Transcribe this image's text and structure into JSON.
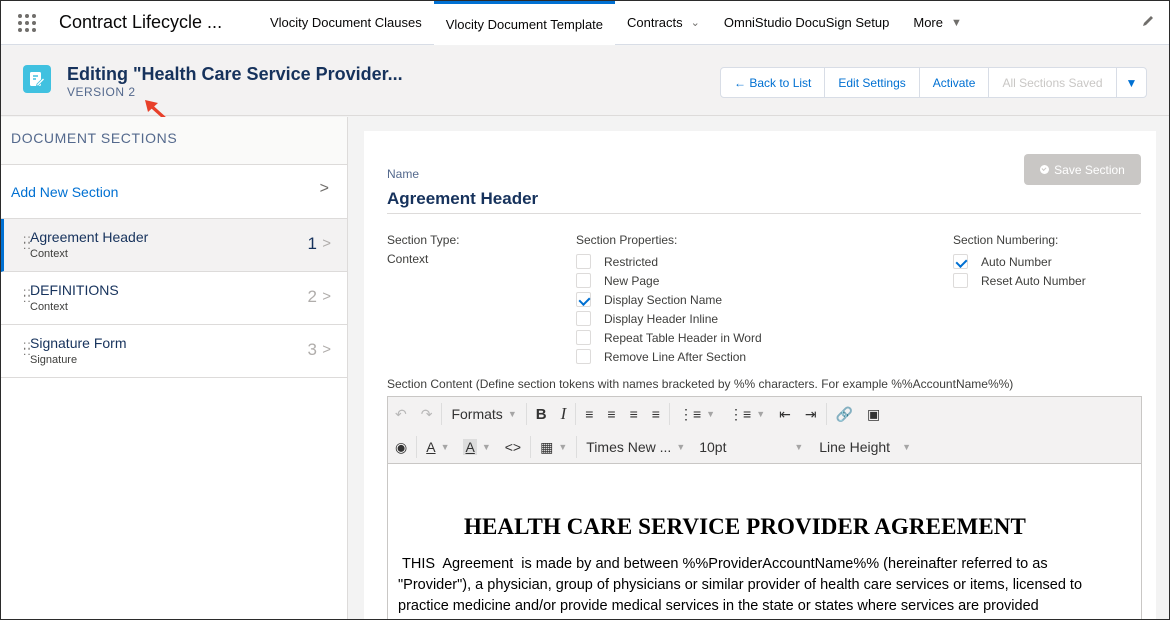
{
  "nav": {
    "app_name": "Contract Lifecycle ...",
    "tabs": [
      {
        "label": "Vlocity Document Clauses"
      },
      {
        "label": "Vlocity Document Template"
      },
      {
        "label": "Contracts"
      },
      {
        "label": "OmniStudio DocuSign Setup"
      },
      {
        "label": "More"
      }
    ]
  },
  "header": {
    "title": "Editing \"Health Care Service Provider...",
    "version": "VERSION 2",
    "buttons": {
      "back": "← Back to List",
      "edit_settings": "Edit Settings",
      "activate": "Activate",
      "saved_status": "All Sections Saved"
    }
  },
  "sidebar": {
    "title": "DOCUMENT SECTIONS",
    "add_section": "Add New Section",
    "sections": [
      {
        "name": "Agreement Header",
        "type": "Context",
        "number": "1"
      },
      {
        "name": "DEFINITIONS",
        "type": "Context",
        "number": "2"
      },
      {
        "name": "Signature Form",
        "type": "Signature",
        "number": "3"
      }
    ]
  },
  "section": {
    "name_label": "Name",
    "name": "Agreement Header",
    "save_button": "Save Section",
    "type_label": "Section Type:",
    "type_value": "Context",
    "properties_label": "Section Properties:",
    "properties": [
      {
        "label": "Restricted",
        "checked": false
      },
      {
        "label": "New Page",
        "checked": false
      },
      {
        "label": "Display Section Name",
        "checked": true
      },
      {
        "label": "Display Header Inline",
        "checked": false
      },
      {
        "label": "Repeat Table Header in Word",
        "checked": false
      },
      {
        "label": "Remove Line After Section",
        "checked": false
      }
    ],
    "numbering_label": "Section Numbering:",
    "numbering": [
      {
        "label": "Auto Number",
        "checked": true
      },
      {
        "label": "Reset Auto Number",
        "checked": false
      }
    ],
    "content_label": "Section Content (Define section tokens with names bracketed by %% characters. For example %%AccountName%%)"
  },
  "editor": {
    "formats": "Formats",
    "font": "Times New ...",
    "size": "10pt",
    "line_height": "Line Height",
    "doc_heading": "HEALTH CARE SERVICE PROVIDER AGREEMENT",
    "doc_body": " THIS  Agreement  is made by and between %%ProviderAccountName%% (hereinafter referred to as \"Provider\"), a physician, group of physicians or similar provider of health care services or items, licensed to practice medicine and/or provide medical services in the state or states where services are provided"
  }
}
